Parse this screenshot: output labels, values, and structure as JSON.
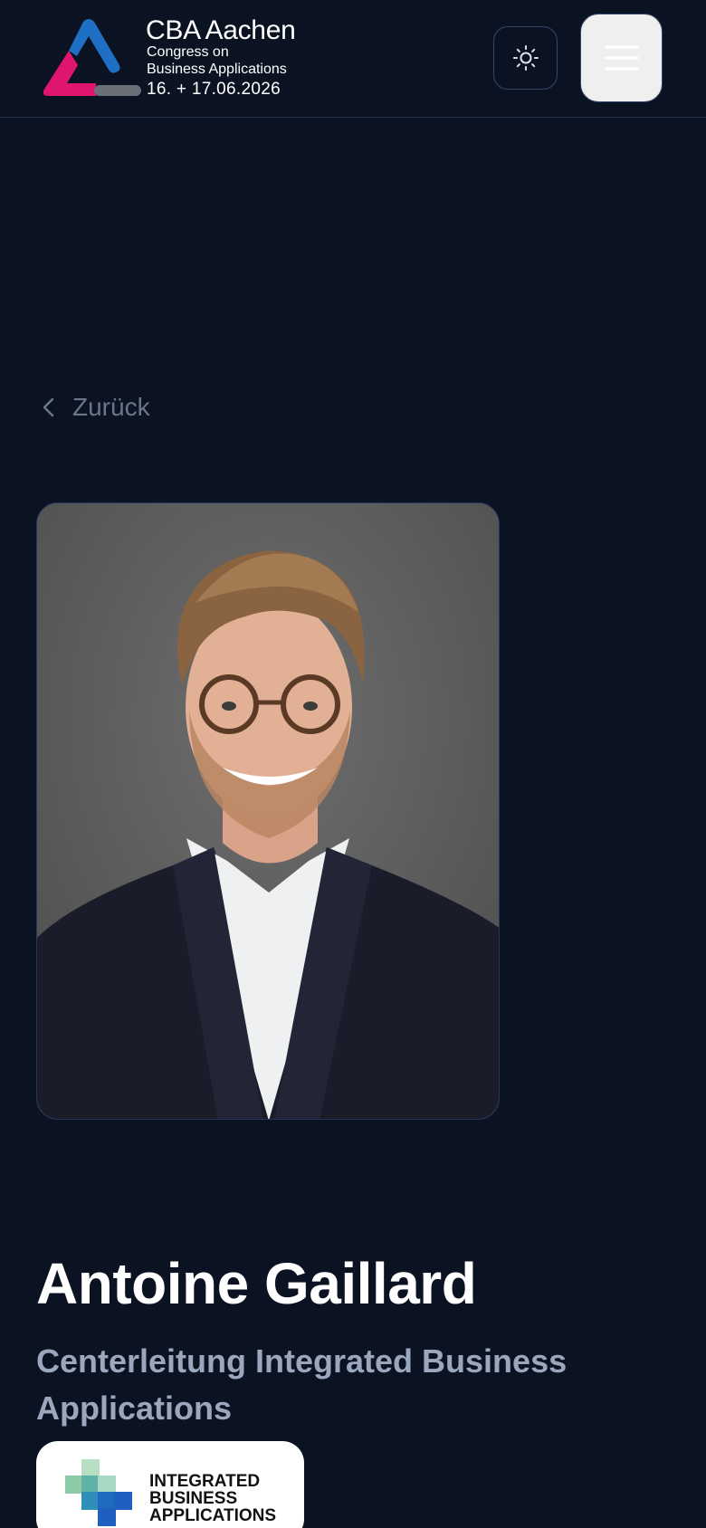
{
  "header": {
    "logo_title": "CBA Aachen",
    "logo_line1": "Congress on",
    "logo_line2": "Business Applications",
    "logo_date": "16. + 17.06.2026",
    "theme_toggle_icon": "sun-icon",
    "menu_icon": "hamburger-menu-icon"
  },
  "nav": {
    "back_label": "Zurück",
    "back_icon": "chevron-left-icon"
  },
  "speaker": {
    "name": "Antoine Gaillard",
    "role": "Centerleitung Integrated Business Applications",
    "company_logo": {
      "line1": "INTEGRATED",
      "line2": "BUSINESS",
      "line3": "APPLICATIONS"
    }
  },
  "colors": {
    "background": "#0b1322",
    "border": "#34486a",
    "muted_text": "#6b7689",
    "role_text": "#9aa7bd",
    "logo_blue": "#1f6fc5",
    "logo_magenta": "#e0156f"
  }
}
